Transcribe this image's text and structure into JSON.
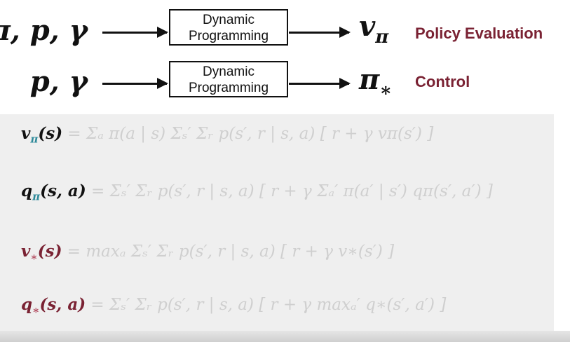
{
  "rows": [
    {
      "inputs": "π, p, γ",
      "box_line1": "Dynamic",
      "box_line2": "Programming",
      "output_main": "v",
      "output_sub": "π",
      "role": "Policy Evaluation"
    },
    {
      "inputs": "p, γ",
      "box_line1": "Dynamic",
      "box_line2": "Programming",
      "output_main": "π",
      "output_sub": "∗",
      "role": "Control"
    }
  ],
  "equations": [
    {
      "lhs_main": "v",
      "lhs_sub": "π",
      "lhs_args": "(s)",
      "rhs": "= Σₐ π(a | s) Σₛ′ Σᵣ p(s′, r | s, a) [ r + γ vπ(s′) ]"
    },
    {
      "lhs_main": "q",
      "lhs_sub": "π",
      "lhs_args": "(s, a)",
      "rhs": "= Σₛ′ Σᵣ p(s′, r | s, a) [ r + γ Σₐ′ π(a′ | s′) qπ(s′, a′) ]"
    },
    {
      "lhs_main": "v",
      "lhs_sub": "∗",
      "lhs_args": "(s)",
      "rhs": "= maxₐ Σₛ′ Σᵣ p(s′, r | s, a) [ r + γ v∗(s′) ]"
    },
    {
      "lhs_main": "q",
      "lhs_sub": "∗",
      "lhs_args": "(s, a)",
      "rhs": "= Σₛ′ Σᵣ p(s′, r | s, a) [ r + γ maxₐ′ q∗(s′, a′) ]"
    }
  ],
  "colors": {
    "role_text": "#7a2233",
    "faded_math": "#cfcfcf",
    "panel": "#efefef",
    "subscript_pi": "#2e8a9a",
    "subscript_star": "#b0455a"
  }
}
